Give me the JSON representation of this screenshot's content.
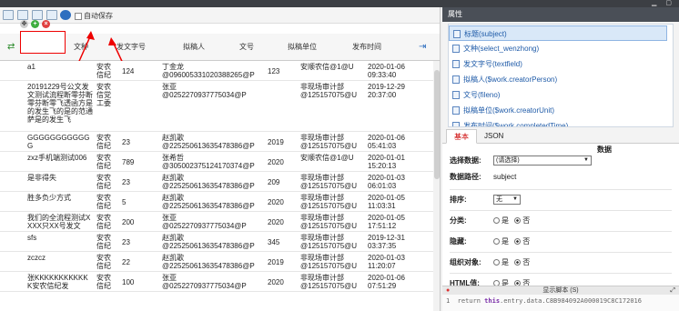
{
  "toolbar": {
    "autosave_label": "自动保存"
  },
  "columns": [
    {
      "label": "标题"
    },
    {
      "label": "文种"
    },
    {
      "label": "发文字号"
    },
    {
      "label": "拟稿人"
    },
    {
      "label": "文号"
    },
    {
      "label": "拟稿单位"
    },
    {
      "label": "发布时间"
    }
  ],
  "rows": [
    {
      "title": "a1",
      "type": "安农信纪",
      "num": "124",
      "author": "丁金龙\n@096005331020388265@P",
      "docno": "123",
      "unit": "安顺农信@1@U",
      "time": "2020-01-06\n09:33:40"
    },
    {
      "title": "20191229号公文发文测试流程断零芬断零芬断零飞透函方是的发生飞的是的范通萨是的发生飞",
      "type": "安农信党工委",
      "num": "",
      "author": "张亚\n@02522709377750​34@P",
      "docno": "",
      "unit": "非现场审计部\n@125157075@U",
      "time": "2019-12-29\n20:37:00"
    },
    {
      "title": "GGGGGGGGGGGG",
      "type": "安农信纪",
      "num": "23",
      "author": "赵凯歌\n@225250613635478386@P",
      "docno": "2019",
      "unit": "非现场审计部\n@125157075@U",
      "time": "2020-01-06\n05:41:03"
    },
    {
      "title": "zxz手机端测试006",
      "type": "安农信纪",
      "num": "789",
      "author": "张希哲\n@305002375124170374@P",
      "docno": "2020",
      "unit": "安顺农信@1@U",
      "time": "2020-01-01\n15:20:13"
    },
    {
      "title": "是非得失",
      "type": "安农信纪",
      "num": "23",
      "author": "赵凯歌\n@225250613635478386@P",
      "docno": "209",
      "unit": "非现场审计部\n@125157075@U",
      "time": "2020-01-03\n06:01:03"
    },
    {
      "title": "胜多负少方式",
      "type": "安农信纪",
      "num": "5",
      "author": "赵凯歌\n@225250613635478386@P",
      "docno": "2020",
      "unit": "非现场审计部\n@125157075@U",
      "time": "2020-01-05\n11:03:31"
    },
    {
      "title": "我们的全流程测试XXXX只XX号发文",
      "type": "安农信纪",
      "num": "200",
      "author": "张亚\n@025227093777503​4@P",
      "docno": "2020",
      "unit": "非现场审计部\n@125157075@U",
      "time": "2020-01-05\n17:51:12"
    },
    {
      "title": "sfs",
      "type": "安农信纪",
      "num": "23",
      "author": "赵凯歌\n@225250613635478386@P",
      "docno": "345",
      "unit": "非现场审计部\n@125157075@U",
      "time": "2019-12-31\n03:37:35"
    },
    {
      "title": "zczcz",
      "type": "安农信纪",
      "num": "22",
      "author": "赵凯歌\n@225250613635478386@P",
      "docno": "2019",
      "unit": "非现场审计部\n@125157075@U",
      "time": "2020-01-03\n11:20:07"
    },
    {
      "title": "张KKKKKKKKKKKK安农信纪发",
      "type": "安农信纪",
      "num": "100",
      "author": "张亚\n@025227093777503​4@P",
      "docno": "2020",
      "unit": "非现场审计部\n@125157075@U",
      "time": "2020-01-06\n07:51:29"
    }
  ],
  "panel": {
    "title": "属性",
    "fields": [
      "标题(subject)",
      "文种(select_wenzhong)",
      "发文字号(textfield)",
      "拟稿人($work.creatorPerson)",
      "文号(fileno)",
      "拟稿单位($work.creatorUnit)",
      "发布时间($work.completedTime)"
    ],
    "tabs": [
      "基本",
      "JSON"
    ],
    "section_label": "数据",
    "select_data_label": "选择数据:",
    "select_data_value": "(请选择)",
    "data_path_label": "数据路径:",
    "data_path_value": "subject",
    "sort_label": "排序:",
    "sort_value": "无",
    "category_label": "分类:",
    "hidden_label": "隐藏:",
    "group_label": "组织对象:",
    "html_label": "HTML值:",
    "yes": "是",
    "no": "否",
    "script_label": "显示脚本 (S)",
    "script_line_no": "1",
    "script_kw_return": "return",
    "script_kw_this": "this",
    "script_code": ".entry.data.C8B984092A000019C8C172016"
  }
}
